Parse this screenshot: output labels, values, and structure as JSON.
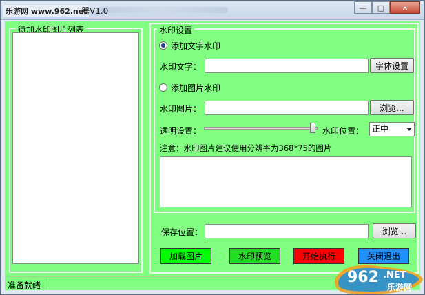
{
  "window": {
    "watermark_site": "乐游网 www.962.net",
    "title_version": "器V1.0"
  },
  "window_controls": {
    "minimize": "—",
    "maximize": "□",
    "close": "✕"
  },
  "list_panel": {
    "title": "待加水印图片列表"
  },
  "settings": {
    "group_title": "水印设置",
    "text_watermark_radio": "添加文字水印",
    "text_watermark_label": "水印文字：",
    "text_watermark_value": "",
    "font_button": "字体设置",
    "image_watermark_radio": "添加图片水印",
    "image_watermark_label": "水印图片：",
    "image_watermark_value": "",
    "browse_button": "浏览...",
    "opacity_label": "透明设置：",
    "opacity_level_percent": 98,
    "position_label": "水印位置：",
    "position_value": "正中",
    "note": "注意：水印图片建议使用分辨率为368*75的图片",
    "note_area_value": ""
  },
  "save": {
    "label": "保存位置：",
    "value": "",
    "browse_button": "浏览..."
  },
  "actions": {
    "load": "加载图片",
    "preview": "水印预览",
    "start": "开始执行",
    "exit": "关闭退出"
  },
  "status": {
    "text": "准备就绪"
  },
  "logo": {
    "brand": "962",
    "suffix": ".NET",
    "caption": "乐游网"
  },
  "colors": {
    "panel_green": "#80ff80",
    "load_button": "#00ff00",
    "preview_button": "#22dd22",
    "start_button": "#ff0000",
    "exit_button": "#1e90ff"
  }
}
